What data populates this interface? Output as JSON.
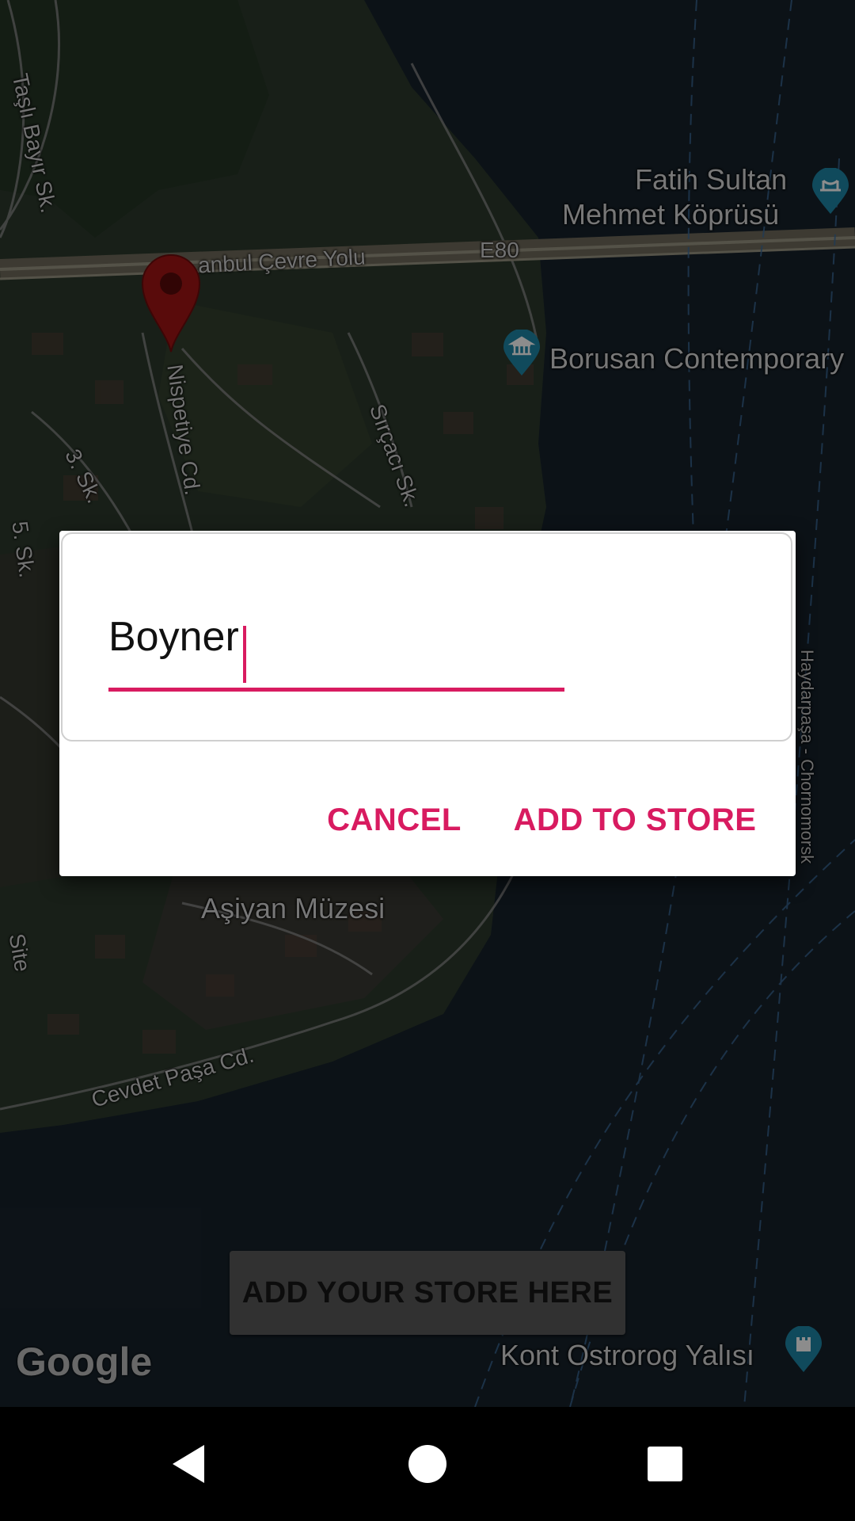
{
  "map": {
    "labels": {
      "fatih_line1": "Fatih Sultan",
      "fatih_line2": "Mehmet Köprüsü",
      "borusan": "Borusan Contemporary",
      "asiyan": "Aşiyan Müzesi",
      "kont": "Kont Ostrorog Yalısı",
      "cevre_yolu": "anbul Çevre Yolu",
      "e80": "E80",
      "tasli_bayir": "Taşlı Bayır Sk.",
      "nispetiye": "Nispetiye Cd.",
      "sircaci": "Sırçacı Sk.",
      "uc_sk": "3. Sk.",
      "bes_sk": "5. Sk.",
      "cevdet_pasa": "Cevdet Paşa Cd.",
      "site": "Site",
      "haydarpasa": "Haydarpaşa - Chornomorsk"
    },
    "google_logo": "Google",
    "add_store_button": "ADD YOUR STORE HERE"
  },
  "dialog": {
    "input_value": "Boyner",
    "cancel_label": "CANCEL",
    "confirm_label": "ADD TO STORE"
  },
  "colors": {
    "accent": "#d81b60",
    "marker": "#a31515"
  },
  "navbar": {
    "icons": [
      "back-icon",
      "home-icon",
      "recents-icon"
    ]
  }
}
